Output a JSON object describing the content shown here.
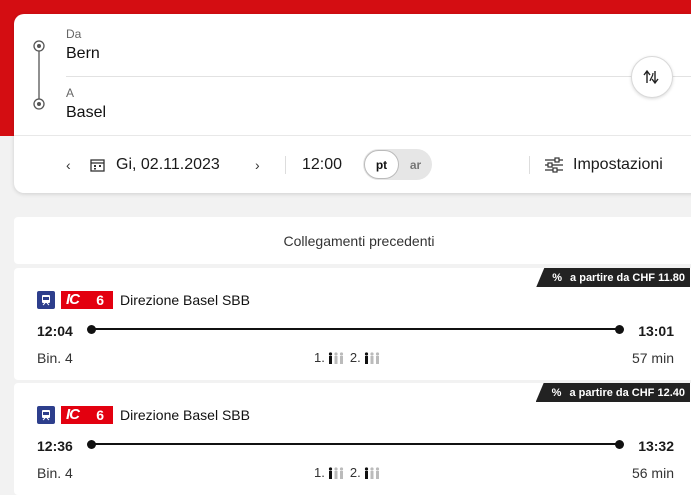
{
  "search": {
    "from_label": "Da",
    "from_value": "Bern",
    "to_label": "A",
    "to_value": "Basel",
    "date": "Gi, 02.11.2023",
    "time": "12:00",
    "toggle_on": "pt",
    "toggle_off": "ar",
    "settings_label": "Impostazioni"
  },
  "previous_connections_label": "Collegamenti precedenti",
  "connections": [
    {
      "price": "a partire da CHF  11.80",
      "line": "6",
      "line_prefix": "IC",
      "direction": "Direzione Basel SBB",
      "departure": "12:04",
      "arrival": "13:01",
      "platform": "Bin. 4",
      "class1": "1.",
      "class2": "2.",
      "duration": "57 min"
    },
    {
      "price": "a partire da CHF  12.40",
      "line": "6",
      "line_prefix": "IC",
      "direction": "Direzione Basel SBB",
      "departure": "12:36",
      "arrival": "13:32",
      "platform": "Bin. 4",
      "class1": "1.",
      "class2": "2.",
      "duration": "56 min"
    }
  ],
  "colors": {
    "brand_red": "#d40d12",
    "ic_red": "#e3000f",
    "train_blue": "#2d3e8c"
  },
  "icons": [
    "route-icon",
    "swap-icon",
    "chevron-left-icon",
    "calendar-icon",
    "chevron-right-icon",
    "settings-sliders-icon",
    "train-icon",
    "occupancy-icon"
  ]
}
